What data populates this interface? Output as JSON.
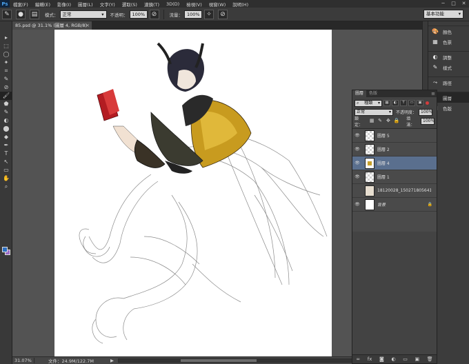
{
  "app": {
    "logo": "Ps"
  },
  "menu": [
    "檔案(F)",
    "編輯(E)",
    "影像(I)",
    "圖層(L)",
    "文字(Y)",
    "選取(S)",
    "濾鏡(T)",
    "3D(D)",
    "檢視(V)",
    "視窗(W)",
    "說明(H)"
  ],
  "window_controls": {
    "minimize": "─",
    "maximize": "□",
    "close": "✕"
  },
  "options_bar": {
    "mode_label": "模式：",
    "mode_value": "正常",
    "opacity_label": "不透明：",
    "opacity_value": "100%",
    "flow_label": "流量：",
    "flow_value": "100%",
    "workspace": "基本功能"
  },
  "document": {
    "tab_title": "85.psd @ 31.1% (圖層 4, RGB/8)",
    "close_glyph": "×"
  },
  "tools": [
    "▸",
    "⬚",
    "◯",
    "✦",
    "⌗",
    "✎",
    "⊘",
    "🖌",
    "⬟",
    "✎",
    "◐",
    "⬤",
    "◆",
    "✒",
    "T",
    "↖",
    "▭",
    "✋",
    "⌕"
  ],
  "status": {
    "zoom": "31.07%",
    "doc_size": "文件：24.9M/122.7M",
    "arrow": "▶"
  },
  "dock_panels": [
    {
      "icon": "🎨",
      "label": "顏色"
    },
    {
      "icon": "▦",
      "label": "色票"
    },
    {
      "icon": "◐",
      "label": "調整"
    },
    {
      "icon": "✎",
      "label": "樣式"
    },
    {
      "icon": "⤳",
      "label": "路徑"
    },
    {
      "icon": "◈",
      "label": "圖層"
    },
    {
      "icon": "▣",
      "label": "色版"
    }
  ],
  "layers_panel": {
    "tabs": [
      "圖層",
      "色版"
    ],
    "kind_filter": "種類",
    "blend_mode": "正常",
    "opacity_label": "不透明度：",
    "opacity_value": "100%",
    "lock_label": "鎖定：",
    "fill_label": "填滿：",
    "fill_value": "100%",
    "layers": [
      {
        "name": "圖層 5",
        "visible": true,
        "thumb": "transparent",
        "selected": false
      },
      {
        "name": "圖層 2",
        "visible": true,
        "thumb": "transparent",
        "selected": false
      },
      {
        "name": "圖層 4",
        "visible": true,
        "thumb": "char",
        "selected": true
      },
      {
        "name": "圖層 1",
        "visible": true,
        "thumb": "transparent",
        "selected": false
      },
      {
        "name": "18120028_1502718056415...",
        "visible": false,
        "thumb": "sketch",
        "selected": false
      },
      {
        "name": "背景",
        "visible": true,
        "thumb": "white",
        "selected": false,
        "locked": true
      }
    ],
    "footer": [
      "∞",
      "fx",
      "◙",
      "◐",
      "▭",
      "▣",
      "🗑"
    ]
  },
  "colors": {
    "foreground": "#2d6fc1",
    "background": "#9b6bc7",
    "selection": "#5a6f8e"
  }
}
